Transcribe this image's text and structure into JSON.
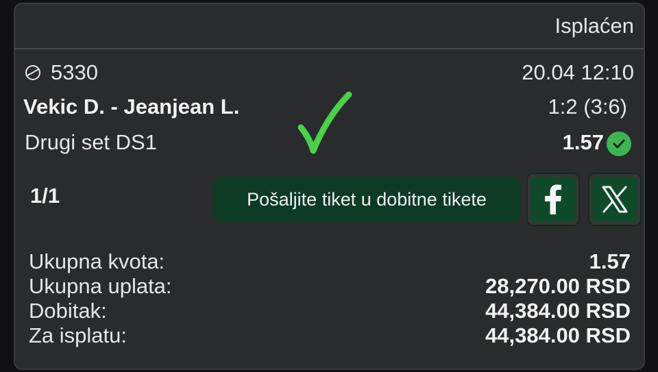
{
  "ticket": {
    "status": "Isplaćen",
    "match_id": "5330",
    "datetime": "20.04 12:10",
    "teams": "Vekic D. - Jeanjean L.",
    "score": "1:2 (3:6)",
    "market": "Drugi set DS1",
    "odd": "1.57",
    "count": "1/1"
  },
  "actions": {
    "send_label": "Pošaljite tiket u dobitne tikete",
    "facebook_icon": "facebook-icon",
    "x_icon": "x-icon"
  },
  "summary": {
    "total_odds_label": "Ukupna kvota:",
    "total_odds_value": "1.57",
    "stake_label": "Ukupna uplata:",
    "stake_value": "28,270.00 RSD",
    "win_label": "Dobitak:",
    "win_value": "44,384.00 RSD",
    "payout_label": "Za isplatu:",
    "payout_value": "44,384.00 RSD"
  },
  "colors": {
    "card_bg": "#2a2b2d",
    "accent_green": "#3fb551",
    "button_green": "#0d3a25"
  }
}
